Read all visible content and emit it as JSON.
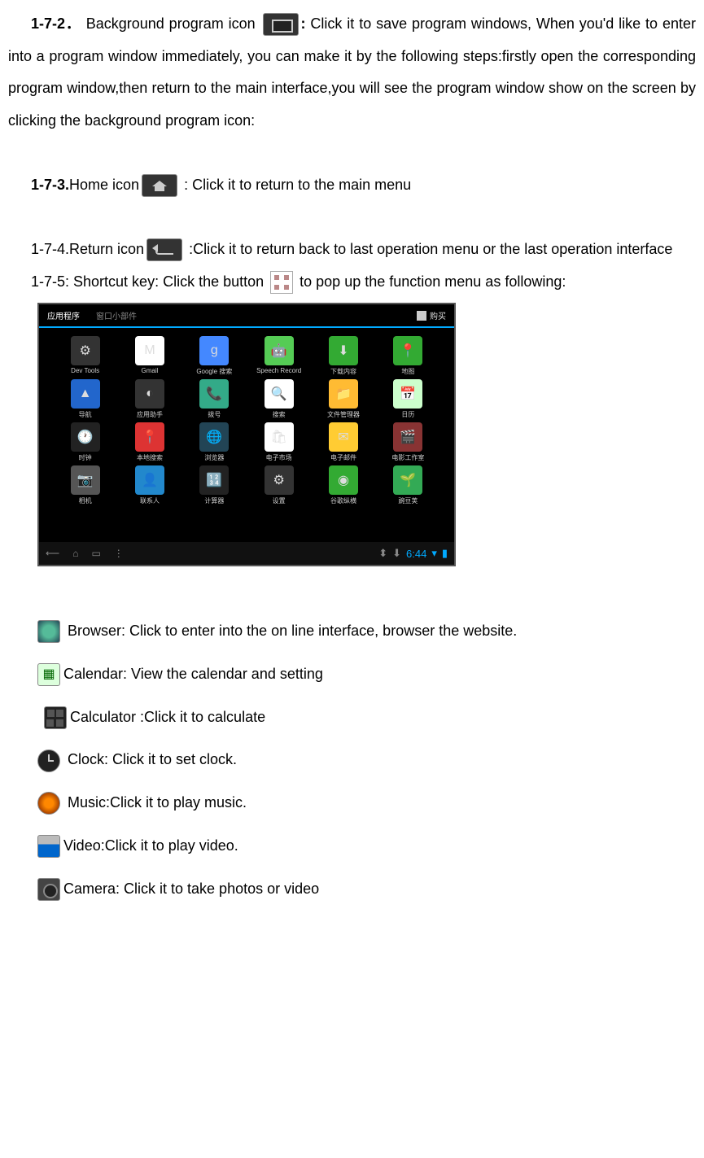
{
  "sections": {
    "s172_label": "1-7-2．",
    "s172_prefix": "Background program icon ",
    "s172_suffix": ": ",
    "s172_body": "Click it to save program windows, When you'd like to enter into a program window immediately, you can make it by the following steps:firstly open the corresponding program window,then return to the main interface,you will see the program window show on the screen by clicking the background program icon:",
    "s173_label": "1-7-3.",
    "s173_prefix": "Home icon",
    "s173_body": " : Click it to return to the main menu",
    "s174_prefix": "1-7-4.Return icon",
    "s174_body": " :Click it to return back to last operation menu or the last operation interface",
    "s175_prefix": "1-7-5: Shortcut key: Click the button ",
    "s175_suffix": " to pop up the function menu as following:"
  },
  "screenshot": {
    "tab1": "应用程序",
    "tab2": "窗口小部件",
    "purchase": "购买",
    "time": "6:44",
    "apps": [
      {
        "label": "Dev Tools",
        "bg": "#333",
        "glyph": "⚙"
      },
      {
        "label": "Gmail",
        "bg": "#fff",
        "glyph": "M"
      },
      {
        "label": "Google 搜索",
        "bg": "#48f",
        "glyph": "g"
      },
      {
        "label": "Speech Record",
        "bg": "#5c5",
        "glyph": "🤖"
      },
      {
        "label": "下载内容",
        "bg": "#3a3",
        "glyph": "⬇"
      },
      {
        "label": "地图",
        "bg": "#3a3",
        "glyph": "📍"
      },
      {
        "label": "导航",
        "bg": "#26c",
        "glyph": "▲"
      },
      {
        "label": "应用助手",
        "bg": "#333",
        "glyph": "◐"
      },
      {
        "label": "拨号",
        "bg": "#3a8",
        "glyph": "📞"
      },
      {
        "label": "搜索",
        "bg": "#fff",
        "glyph": "🔍"
      },
      {
        "label": "文件管理器",
        "bg": "#fb3",
        "glyph": "📁"
      },
      {
        "label": "日历",
        "bg": "#cfc",
        "glyph": "📅"
      },
      {
        "label": "时钟",
        "bg": "#222",
        "glyph": "🕐"
      },
      {
        "label": "本地搜索",
        "bg": "#d33",
        "glyph": "📍"
      },
      {
        "label": "浏览器",
        "bg": "#245",
        "glyph": "🌐"
      },
      {
        "label": "电子市场",
        "bg": "#fff",
        "glyph": "🛍"
      },
      {
        "label": "电子邮件",
        "bg": "#fc3",
        "glyph": "✉"
      },
      {
        "label": "电影工作室",
        "bg": "#833",
        "glyph": "🎬"
      },
      {
        "label": "相机",
        "bg": "#555",
        "glyph": "📷"
      },
      {
        "label": "联系人",
        "bg": "#28c",
        "glyph": "👤"
      },
      {
        "label": "计算器",
        "bg": "#222",
        "glyph": "🔢"
      },
      {
        "label": "设置",
        "bg": "#333",
        "glyph": "⚙"
      },
      {
        "label": "谷歌纵横",
        "bg": "#3a3",
        "glyph": "◉"
      },
      {
        "label": "豌豆荚",
        "bg": "#3a5",
        "glyph": "🌱"
      }
    ]
  },
  "app_list": {
    "browser": " Browser: Click to enter into the on line interface, browser the website.",
    "calendar": "Calendar: View the calendar and setting",
    "calculator": "Calculator :Click it to calculate",
    "clock": " Clock: Click it to set clock.",
    "music": " Music:Click it to play music.",
    "video": "Video:Click it to play video.",
    "camera": "Camera: Click it to take photos or video"
  }
}
